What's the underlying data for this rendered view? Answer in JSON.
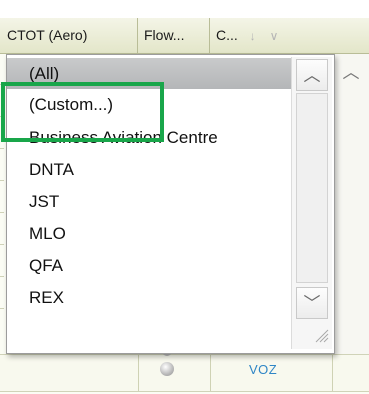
{
  "grid": {
    "columns": {
      "ctot": "CTOT (Aero)",
      "flow": "Flow...",
      "cflag": "C..."
    },
    "icons": {
      "sort": "sort-down-arrow-icon",
      "filter": "filter-dropdown-chevron-icon"
    },
    "bottom_row": {
      "code": "VOZ",
      "status": "status-dot-icon"
    }
  },
  "dropdown": {
    "items": [
      {
        "label": "(All)",
        "selected": true
      },
      {
        "label": "(Custom...)",
        "selected": false
      },
      {
        "label": "Business Aviation Centre",
        "selected": false
      },
      {
        "label": "DNTA",
        "selected": false
      },
      {
        "label": "JST",
        "selected": false
      },
      {
        "label": "MLO",
        "selected": false
      },
      {
        "label": "QFA",
        "selected": false
      },
      {
        "label": "REX",
        "selected": false
      }
    ]
  },
  "colors": {
    "highlight": "#19a64a",
    "header_bg": "#e8ebd3",
    "selected_bg": "#bfc0c2",
    "link_text": "#2f86c6"
  }
}
